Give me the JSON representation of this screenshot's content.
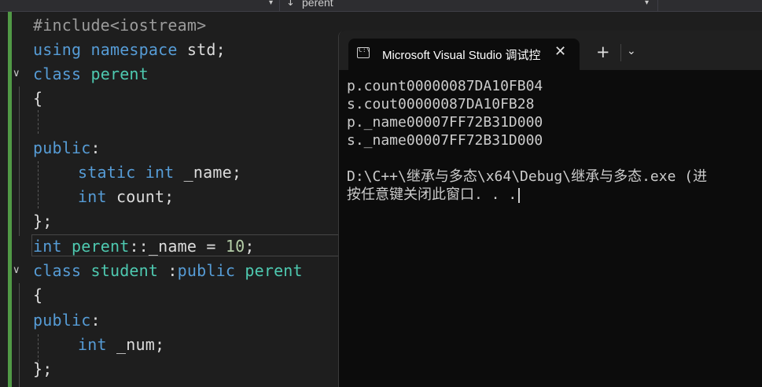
{
  "toolbar": {
    "scope_dropdown_caret": "▾",
    "member_dropdown_arrow": "↓",
    "member_dropdown_label": "perent",
    "member_dropdown_caret": "▾"
  },
  "code": {
    "lines": [
      [
        "#include<iostream>"
      ],
      [
        "using",
        " ",
        "namespace",
        " std;"
      ],
      [
        "class",
        " ",
        "perent"
      ],
      [
        "{"
      ],
      [
        ""
      ],
      [
        "public",
        ":"
      ],
      [
        "static",
        " ",
        "int",
        " _name;"
      ],
      [
        "int",
        " count;"
      ],
      [
        "};"
      ],
      [
        "int",
        " ",
        "perent",
        "::_name = ",
        "10",
        ";"
      ],
      [
        "class",
        " ",
        "student",
        " :",
        "public",
        " ",
        "perent"
      ],
      [
        "{"
      ],
      [
        "public",
        ":"
      ],
      [
        "int",
        " _num;"
      ],
      [
        "};"
      ]
    ],
    "fold_glyph": "∨"
  },
  "terminal": {
    "tab_icon_text": "C:\\",
    "tab_title": "Microsoft Visual Studio 调试控",
    "tab_close": "✕",
    "new_tab": "+",
    "tab_menu": "⌄",
    "output": [
      "p.count00000087DA10FB04",
      "s.cout00000087DA10FB28",
      "p._name00007FF72B31D000",
      "s._name00007FF72B31D000",
      "",
      "D:\\C++\\继承与多态\\x64\\Debug\\继承与多态.exe (进",
      "按任意键关闭此窗口. . ."
    ]
  },
  "colors": {
    "keyword": "#569cd6",
    "type": "#4ec9b0",
    "number": "#b5cea8",
    "change_bar": "#57a64a"
  }
}
